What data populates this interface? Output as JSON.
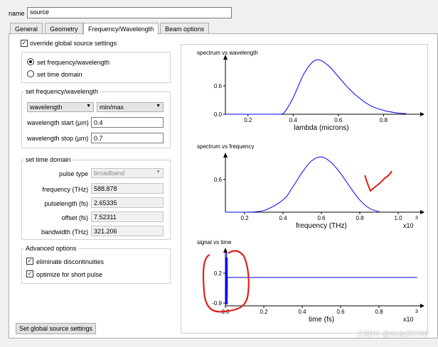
{
  "name": {
    "label": "name",
    "value": "source"
  },
  "tabs": [
    {
      "label": "General"
    },
    {
      "label": "Geometry"
    },
    {
      "label": "Frequency/Wavelength"
    },
    {
      "label": "Beam options"
    }
  ],
  "active_tab": "Frequency/Wavelength",
  "override": {
    "label": "override global source settings",
    "checked": true
  },
  "mode": {
    "options": [
      {
        "label": "set frequency/wavelength",
        "selected": true
      },
      {
        "label": "set time domain",
        "selected": false
      }
    ]
  },
  "freq_group": {
    "title": "set frequency/wavelength",
    "combo_type": "wavelength",
    "combo_range": "min/max",
    "start_label": "wavelength start (µm)",
    "start_value": "0.4",
    "stop_label": "wavelength stop (µm)",
    "stop_value": "0.7"
  },
  "time_group": {
    "title": "set time domain",
    "pulse_type_label": "pulse type",
    "pulse_type_value": "broadband",
    "frequency_label": "frequency (THz)",
    "frequency_value": "588.878",
    "pulselength_label": "pulselength (fs)",
    "pulselength_value": "2.65335",
    "offset_label": "offset (fs)",
    "offset_value": "7.52311",
    "bandwidth_label": "bandwidth (THz)",
    "bandwidth_value": "321.206"
  },
  "advanced": {
    "title": "Advanced options",
    "eliminate_label": "eliminate discontinuities",
    "eliminate_checked": true,
    "optimize_label": "optimize for short pulse",
    "optimize_checked": true
  },
  "set_global_button": "Set global source settings",
  "watermark": "CSDN @zhdy56789",
  "colors": {
    "curve": "#0000ff",
    "annotation": "#e0201a"
  },
  "chart_data": [
    {
      "type": "line",
      "title": "spectrum vs wavelength",
      "xlabel": "lambda (microns)",
      "ylabel": "",
      "xlim": [
        0.1,
        0.95
      ],
      "ylim": [
        0,
        1
      ],
      "xticks": [
        "0.2",
        "0.4",
        "0.6",
        "0.8"
      ],
      "yticks": [
        "0.0",
        "0.6"
      ],
      "multiplier": "",
      "series": [
        {
          "x": [
            0.33,
            0.36,
            0.4,
            0.45,
            0.5,
            0.55,
            0.6,
            0.65,
            0.7,
            0.75,
            0.8,
            0.85,
            0.9
          ],
          "y": [
            0,
            0.03,
            0.3,
            0.75,
            0.98,
            0.9,
            0.68,
            0.45,
            0.27,
            0.14,
            0.07,
            0.03,
            0.01
          ]
        }
      ]
    },
    {
      "type": "line",
      "title": "spectrum vs frequency",
      "xlabel": "frequency (THz)",
      "ylabel": "",
      "xlim": [
        0.1,
        1.1
      ],
      "ylim": [
        0,
        1
      ],
      "xticks": [
        "0.2",
        "0.4",
        "0.6",
        "0.8",
        "1.0"
      ],
      "yticks": [
        "0.6"
      ],
      "multiplier": "x10 3",
      "series": [
        {
          "x": [
            0.2,
            0.3,
            0.4,
            0.45,
            0.5,
            0.55,
            0.6,
            0.65,
            0.7,
            0.75,
            0.8,
            0.85,
            0.9
          ],
          "y": [
            0,
            0.03,
            0.22,
            0.45,
            0.72,
            0.93,
            1.0,
            0.9,
            0.7,
            0.45,
            0.22,
            0.07,
            0.01
          ]
        }
      ]
    },
    {
      "type": "line",
      "title": "signal vs time",
      "xlabel": "time (fs)",
      "ylabel": "",
      "xlim": [
        0,
        1.0
      ],
      "ylim": [
        -1,
        1
      ],
      "xticks": [
        "0.0",
        "0.2",
        "0.4",
        "0.6",
        "0.8"
      ],
      "yticks": [
        "0.2",
        "-0.9"
      ],
      "multiplier": "x10 3",
      "series": [
        {
          "x": [
            0.0,
            0.002,
            0.004,
            0.006,
            0.008,
            0.01,
            0.02,
            1.0
          ],
          "y": [
            0,
            0.3,
            -0.9,
            0.9,
            -0.6,
            0.0,
            0.0,
            0.0
          ]
        }
      ]
    }
  ]
}
